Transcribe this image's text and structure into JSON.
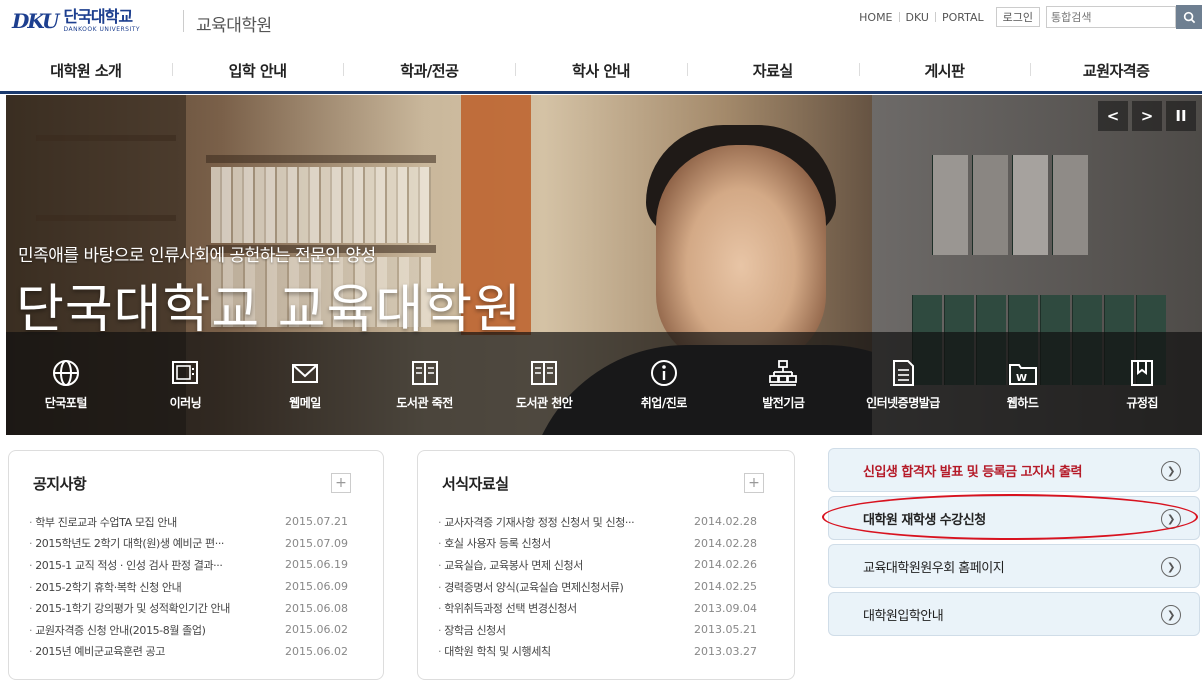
{
  "header": {
    "logo_mark": "DKU",
    "logo_ko": "단국대학교",
    "logo_en": "DANKOOK UNIVERSITY",
    "site_name": "교육대학원",
    "util_links": [
      "HOME",
      "DKU",
      "PORTAL"
    ],
    "login_label": "로그인",
    "search_placeholder": "통합검색"
  },
  "nav": [
    "대학원 소개",
    "입학 안내",
    "학과/전공",
    "학사 안내",
    "자료실",
    "게시판",
    "교원자격증"
  ],
  "hero": {
    "slogan": "민족애를 바탕으로 인류사회에 공헌하는 전문인 양성",
    "title": "단국대학교 교육대학원",
    "controls": [
      "<",
      ">",
      "II"
    ]
  },
  "quick_links": [
    {
      "label": "단국포털",
      "icon": "globe-icon"
    },
    {
      "label": "이러닝",
      "icon": "monitor-icon"
    },
    {
      "label": "웹메일",
      "icon": "mail-icon"
    },
    {
      "label": "도서관 죽전",
      "icon": "book-icon"
    },
    {
      "label": "도서관 천안",
      "icon": "book-icon"
    },
    {
      "label": "취업/진로",
      "icon": "info-icon"
    },
    {
      "label": "발전기금",
      "icon": "org-chart-icon"
    },
    {
      "label": "인터넷증명발급",
      "icon": "document-icon"
    },
    {
      "label": "웹하드",
      "icon": "folder-icon"
    },
    {
      "label": "규정집",
      "icon": "bookmark-icon"
    }
  ],
  "notice": {
    "title": "공지사항",
    "more": "+",
    "items": [
      {
        "title": "학부 진로교과 수업TA 모집 안내",
        "date": "2015.07.21"
      },
      {
        "title": "2015학년도 2학기 대학(원)생 예비군 편···",
        "date": "2015.07.09"
      },
      {
        "title": "2015-1 교직 적성 · 인성 검사 판정 결과···",
        "date": "2015.06.19"
      },
      {
        "title": "2015-2학기 휴학·복학 신청 안내",
        "date": "2015.06.09"
      },
      {
        "title": "2015-1학기 강의평가 및 성적확인기간 안내",
        "date": "2015.06.08"
      },
      {
        "title": "교원자격증 신청 안내(2015-8월 졸업)",
        "date": "2015.06.02"
      },
      {
        "title": "2015년 예비군교육훈련 공고",
        "date": "2015.06.02"
      }
    ]
  },
  "forms": {
    "title": "서식자료실",
    "more": "+",
    "items": [
      {
        "title": "교사자격증 기재사항 정정 신청서 및 신청···",
        "date": "2014.02.28"
      },
      {
        "title": "호실 사용자 등록 신청서",
        "date": "2014.02.28"
      },
      {
        "title": "교육실습, 교육봉사 면제 신청서",
        "date": "2014.02.26"
      },
      {
        "title": "경력증명서 양식(교육실습 면제신청서류)",
        "date": "2014.02.25"
      },
      {
        "title": "학위취득과정 선택 변경신청서",
        "date": "2013.09.04"
      },
      {
        "title": "장학금 신청서",
        "date": "2013.05.21"
      },
      {
        "title": "대학원 학칙 및 시행세칙",
        "date": "2013.03.27"
      }
    ]
  },
  "side_links": [
    {
      "label": "신입생 합격자 발표 및 등록금 고지서 출력",
      "style": "red"
    },
    {
      "label": "대학원 재학생 수강신청",
      "style": "bold"
    },
    {
      "label": "교육대학원원우회 홈페이지",
      "style": "normal"
    },
    {
      "label": "대학원입학안내",
      "style": "normal"
    }
  ],
  "colors": {
    "nav_underline": "#1b3a6e",
    "accent_red": "#b51a28",
    "highlight_oval": "#d8121f",
    "side_link_bg": "#eaf3f9"
  }
}
